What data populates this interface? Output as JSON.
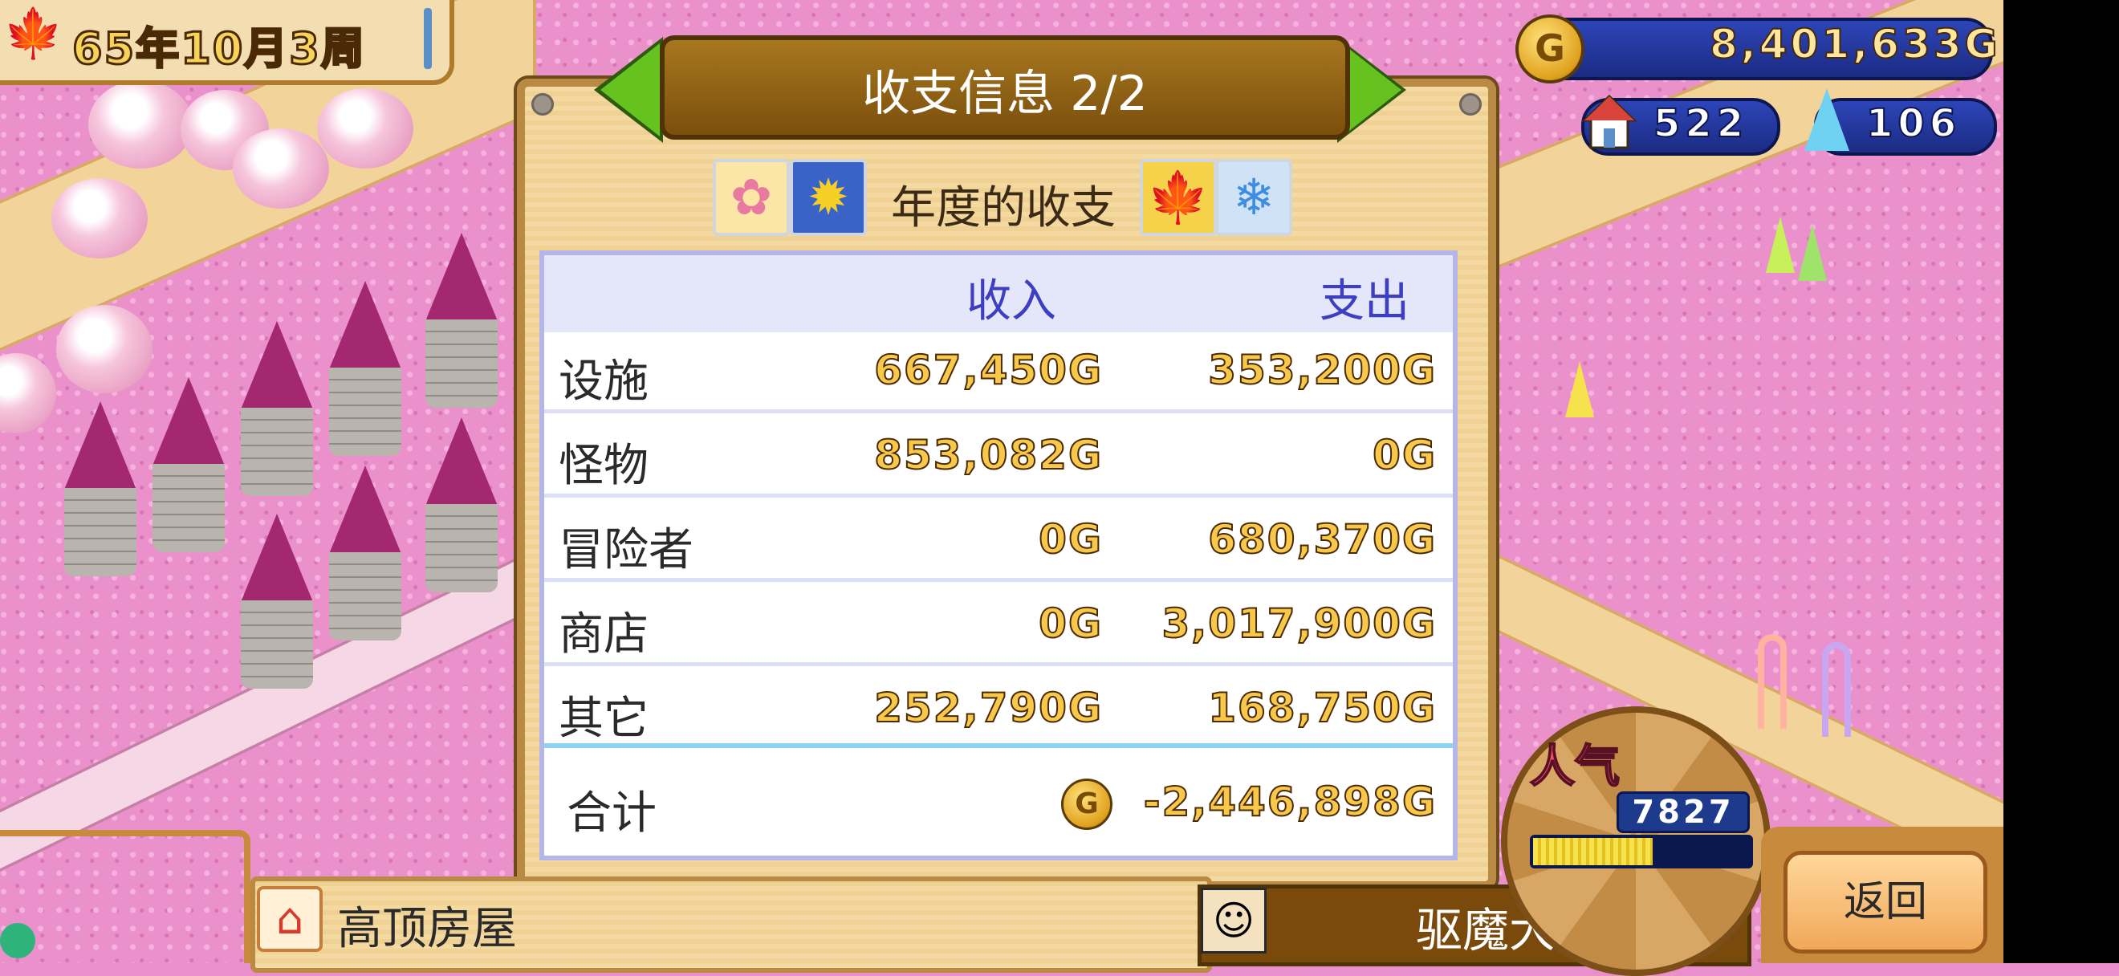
{
  "date": {
    "text": "65年10月3周"
  },
  "hud": {
    "gold": "8,401,633G",
    "gold_icon": "G",
    "town": "522",
    "crystal": "106"
  },
  "panel": {
    "title": "收支信息 2/2",
    "subtitle": "年度的收支",
    "seasons": [
      "spring-blossom-icon",
      "summer-sunflower-icon",
      "autumn-leaf-icon",
      "winter-snowflake-icon"
    ]
  },
  "table": {
    "headers": {
      "income": "收入",
      "expense": "支出"
    },
    "rows": [
      {
        "label": "设施",
        "income": "667,450G",
        "expense": "353,200G"
      },
      {
        "label": "怪物",
        "income": "853,082G",
        "expense": "0G"
      },
      {
        "label": "冒险者",
        "income": "0G",
        "expense": "680,370G"
      },
      {
        "label": "商店",
        "income": "0G",
        "expense": "3,017,900G"
      },
      {
        "label": "其它",
        "income": "252,790G",
        "expense": "168,750G"
      }
    ],
    "total": {
      "label": "合计",
      "coin": "G",
      "value": "-2,446,898G"
    }
  },
  "bottom": {
    "building_name": "高顶房屋",
    "rank_name": "驱魔大家",
    "back_label": "返回"
  },
  "popularity": {
    "label": "人气",
    "value": "7827",
    "bar_fraction": 0.55
  },
  "colors": {
    "accent_gold": "#f7c84a",
    "header_blue": "#3b3fc0",
    "panel_wood": "#b98a43",
    "ground_pink": "#ea91cc"
  }
}
